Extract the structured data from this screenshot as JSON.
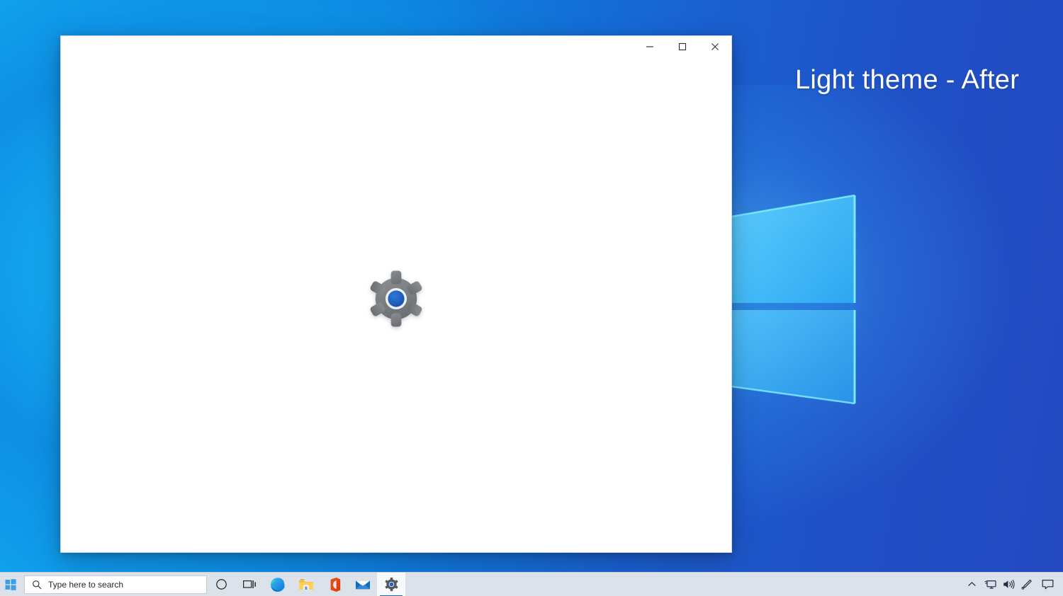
{
  "desktop": {
    "wallpaper_name": "windows-10-hero-light-wallpaper",
    "colors": {
      "left_accent": "#12a9f0",
      "right_accent": "#2449c2",
      "logo_light": "#5ad0ff",
      "logo_mid": "#3fc0fa"
    }
  },
  "overlay": {
    "label": "Light theme - After",
    "color": "#ffffff"
  },
  "window": {
    "title": "",
    "body_background": "#ffffff",
    "splash_icon": "settings-gear-icon",
    "gear_colors": {
      "body": "#7e8084",
      "ring": "#e9ecef",
      "center": "#1f5fbd"
    },
    "controls": {
      "minimize_label": "Minimize",
      "maximize_label": "Maximize",
      "close_label": "Close",
      "minimize_icon": "minimize-icon",
      "maximize_icon": "maximize-icon",
      "close_icon": "close-icon"
    }
  },
  "taskbar": {
    "background": "#dbe2e9",
    "start": {
      "icon": "windows-start-icon",
      "label": "Start",
      "color": "#3a9fe0"
    },
    "search": {
      "icon": "search-icon",
      "placeholder": "Type here to search",
      "value": ""
    },
    "items": [
      {
        "name": "cortana",
        "icon": "cortana-circle-icon",
        "label": "Cortana",
        "active": false
      },
      {
        "name": "task-view",
        "icon": "task-view-icon",
        "label": "Task View",
        "active": false
      },
      {
        "name": "edge",
        "icon": "microsoft-edge-icon",
        "label": "Microsoft Edge",
        "active": false
      },
      {
        "name": "file-explorer",
        "icon": "file-explorer-icon",
        "label": "File Explorer",
        "active": false
      },
      {
        "name": "office",
        "icon": "microsoft-office-icon",
        "label": "Office",
        "active": false
      },
      {
        "name": "mail",
        "icon": "mail-envelope-icon",
        "label": "Mail",
        "active": false
      },
      {
        "name": "settings",
        "icon": "settings-gear-icon",
        "label": "Settings",
        "active": true
      }
    ],
    "tray": [
      {
        "name": "show-hidden-icons",
        "icon": "chevron-up-icon",
        "label": "Show hidden icons"
      },
      {
        "name": "network",
        "icon": "network-monitor-icon",
        "label": "Network"
      },
      {
        "name": "volume",
        "icon": "volume-speaker-icon",
        "label": "Volume"
      },
      {
        "name": "pen-menu",
        "icon": "pen-icon",
        "label": "Windows Ink Workspace"
      },
      {
        "name": "action-center",
        "icon": "action-center-icon",
        "label": "Notifications"
      }
    ]
  }
}
